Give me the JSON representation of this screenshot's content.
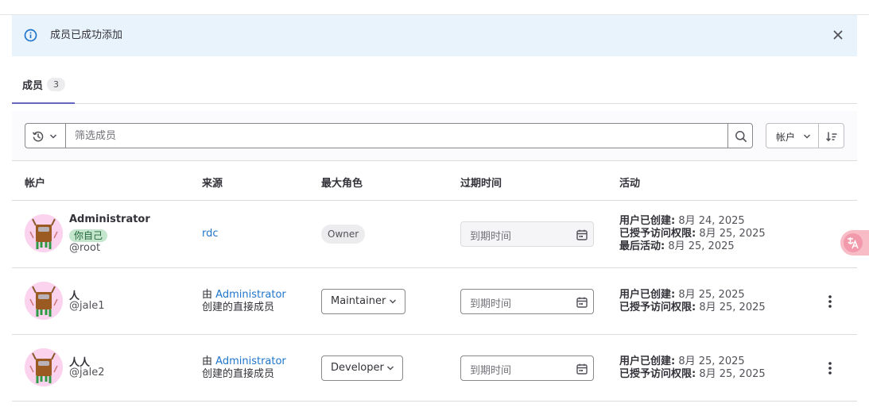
{
  "alert": {
    "message": "成员已成功添加"
  },
  "tabs": [
    {
      "label": "成员",
      "count": "3"
    }
  ],
  "filter": {
    "placeholder": "筛选成员",
    "sort_field": "帐户"
  },
  "table": {
    "headers": {
      "account": "帐户",
      "source": "来源",
      "max_role": "最大角色",
      "expiration": "过期时间",
      "activity": "活动"
    },
    "date_placeholder": "到期时间",
    "rows": [
      {
        "name": "Administrator",
        "badge": "你自己",
        "username": "@root",
        "source": "rdc",
        "role": "Owner",
        "activity": [
          {
            "label": "用户已创建:",
            "value": "8月 24, 2025"
          },
          {
            "label": "已授予访问权限:",
            "value": "8月 25, 2025"
          },
          {
            "label": "最后活动:",
            "value": "8月 25, 2025"
          }
        ]
      },
      {
        "name": "人",
        "username": "@jale1",
        "source_prefix": "由",
        "source_link": "Administrator",
        "source_suffix": "创建的直接成员",
        "role": "Maintainer",
        "activity": [
          {
            "label": "用户已创建:",
            "value": "8月 25, 2025"
          },
          {
            "label": "已授予访问权限:",
            "value": "8月 25, 2025"
          }
        ]
      },
      {
        "name": "人人",
        "username": "@jale2",
        "source_prefix": "由",
        "source_link": "Administrator",
        "source_suffix": "创建的直接成员",
        "role": "Developer",
        "activity": [
          {
            "label": "用户已创建:",
            "value": "8月 25, 2025"
          },
          {
            "label": "已授予访问权限:",
            "value": "8月 25, 2025"
          }
        ]
      }
    ]
  },
  "floating": {
    "icon": "translate-icon"
  }
}
